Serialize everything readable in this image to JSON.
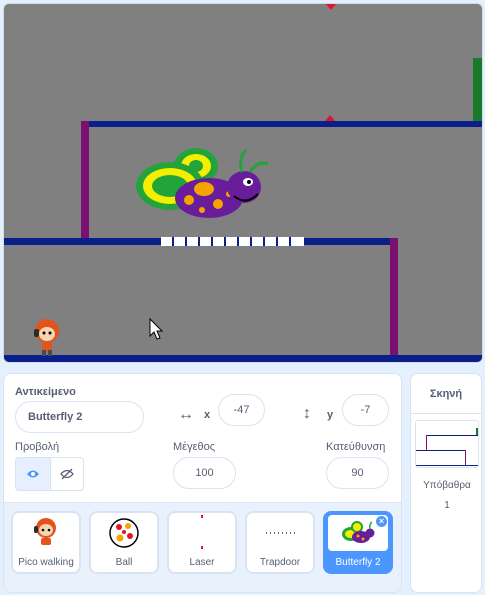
{
  "sprite_info": {
    "sprite_label": "Αντικείμενο",
    "sprite_name": "Butterfly 2",
    "x_label": "x",
    "x_value": "-47",
    "y_label": "y",
    "y_value": "-7",
    "show_label": "Προβολή",
    "size_label": "Μέγεθος",
    "size_value": "100",
    "direction_label": "Κατεύθυνση",
    "direction_value": "90"
  },
  "sprites": [
    {
      "name": "Pico walking",
      "icon": "pico-icon"
    },
    {
      "name": "Ball",
      "icon": "ball-icon"
    },
    {
      "name": "Laser",
      "icon": "laser-icon"
    },
    {
      "name": "Trapdoor",
      "icon": "trapdoor-icon"
    },
    {
      "name": "Butterfly 2",
      "icon": "butterfly-icon",
      "selected": true
    }
  ],
  "stage_pane": {
    "title": "Σκηνή",
    "backdrops_label": "Υπόβαθρα",
    "backdrops_count": "1"
  },
  "colors": {
    "accent": "#4c97ff",
    "stage_bg": "#808080",
    "platform": "#0b1f8a",
    "wall": "#7a1070"
  }
}
